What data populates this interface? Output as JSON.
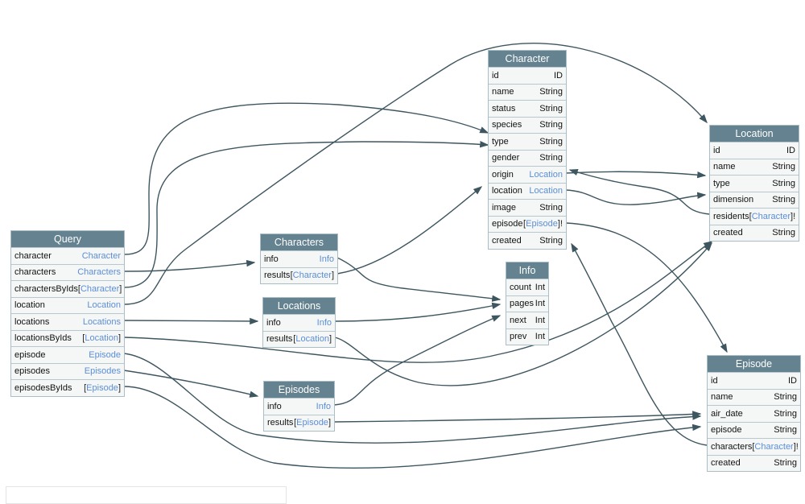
{
  "colors": {
    "header": "#64828f",
    "row": "#f5f7f7",
    "type_link": "#5b8ed6",
    "edge": "#3e5660"
  },
  "tables": [
    {
      "name": "Query",
      "fields": [
        {
          "name": "character",
          "type": "Character"
        },
        {
          "name": "characters",
          "type": "Characters"
        },
        {
          "name": "charactersByIds",
          "type": "Character",
          "list": true
        },
        {
          "name": "location",
          "type": "Location"
        },
        {
          "name": "locations",
          "type": "Locations"
        },
        {
          "name": "locationsByIds",
          "type": "Location",
          "list": true
        },
        {
          "name": "episode",
          "type": "Episode"
        },
        {
          "name": "episodes",
          "type": "Episodes"
        },
        {
          "name": "episodesByIds",
          "type": "Episode",
          "list": true
        }
      ]
    },
    {
      "name": "Characters",
      "fields": [
        {
          "name": "info",
          "type": "Info"
        },
        {
          "name": "results",
          "type": "Character",
          "list": true
        }
      ]
    },
    {
      "name": "Locations",
      "fields": [
        {
          "name": "info",
          "type": "Info"
        },
        {
          "name": "results",
          "type": "Location",
          "list": true
        }
      ]
    },
    {
      "name": "Episodes",
      "fields": [
        {
          "name": "info",
          "type": "Info"
        },
        {
          "name": "results",
          "type": "Episode",
          "list": true
        }
      ]
    },
    {
      "name": "Character",
      "fields": [
        {
          "name": "id",
          "scalar": "ID"
        },
        {
          "name": "name",
          "scalar": "String"
        },
        {
          "name": "status",
          "scalar": "String"
        },
        {
          "name": "species",
          "scalar": "String"
        },
        {
          "name": "type",
          "scalar": "String"
        },
        {
          "name": "gender",
          "scalar": "String"
        },
        {
          "name": "origin",
          "type": "Location"
        },
        {
          "name": "location",
          "type": "Location"
        },
        {
          "name": "image",
          "scalar": "String"
        },
        {
          "name": "episode",
          "type": "Episode",
          "list": true,
          "nonnull": true
        },
        {
          "name": "created",
          "scalar": "String"
        }
      ]
    },
    {
      "name": "Info",
      "fields": [
        {
          "name": "count",
          "scalar": "Int"
        },
        {
          "name": "pages",
          "scalar": "Int"
        },
        {
          "name": "next",
          "scalar": "Int"
        },
        {
          "name": "prev",
          "scalar": "Int"
        }
      ]
    },
    {
      "name": "Location",
      "fields": [
        {
          "name": "id",
          "scalar": "ID"
        },
        {
          "name": "name",
          "scalar": "String"
        },
        {
          "name": "type",
          "scalar": "String"
        },
        {
          "name": "dimension",
          "scalar": "String"
        },
        {
          "name": "residents",
          "type": "Character",
          "list": true,
          "nonnull": true
        },
        {
          "name": "created",
          "scalar": "String"
        }
      ]
    },
    {
      "name": "Episode",
      "fields": [
        {
          "name": "id",
          "scalar": "ID"
        },
        {
          "name": "name",
          "scalar": "String"
        },
        {
          "name": "air_date",
          "scalar": "String"
        },
        {
          "name": "episode",
          "scalar": "String"
        },
        {
          "name": "characters",
          "type": "Character",
          "list": true,
          "nonnull": true
        },
        {
          "name": "created",
          "scalar": "String"
        }
      ]
    }
  ]
}
